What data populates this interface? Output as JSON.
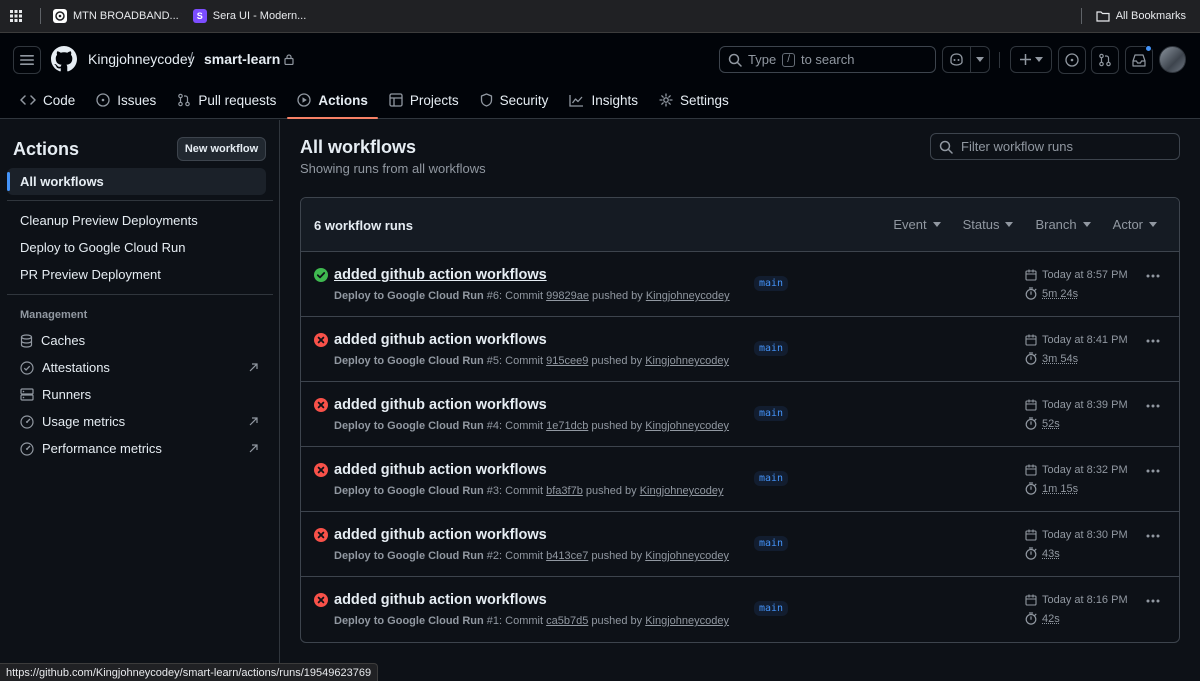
{
  "bookmarks": {
    "items": [
      {
        "label": "MTN BROADBAND...",
        "icon": "router-icon"
      },
      {
        "label": "Sera UI - Modern...",
        "icon": "sera-icon",
        "icon_letter": "S"
      }
    ],
    "all_bookmarks": "All Bookmarks"
  },
  "header": {
    "owner": "Kingjohneycodey",
    "separator": "/",
    "repo": "smart-learn",
    "search": {
      "prefix": "Type",
      "key": "/",
      "suffix": "to search"
    }
  },
  "tabs": [
    {
      "label": "Code",
      "icon": "code-icon"
    },
    {
      "label": "Issues",
      "icon": "issue-icon"
    },
    {
      "label": "Pull requests",
      "icon": "pull-request-icon"
    },
    {
      "label": "Actions",
      "icon": "play-icon",
      "active": true
    },
    {
      "label": "Projects",
      "icon": "table-icon"
    },
    {
      "label": "Security",
      "icon": "shield-icon"
    },
    {
      "label": "Insights",
      "icon": "graph-icon"
    },
    {
      "label": "Settings",
      "icon": "gear-icon"
    }
  ],
  "sidebar": {
    "title": "Actions",
    "new_workflow": "New workflow",
    "all_workflows": "All workflows",
    "workflows": [
      "Cleanup Preview Deployments",
      "Deploy to Google Cloud Run",
      "PR Preview Deployment"
    ],
    "management_heading": "Management",
    "management": [
      {
        "label": "Caches",
        "icon": "database-icon"
      },
      {
        "label": "Attestations",
        "icon": "verified-icon",
        "external": true
      },
      {
        "label": "Runners",
        "icon": "server-icon"
      },
      {
        "label": "Usage metrics",
        "icon": "meter-icon",
        "external": true
      },
      {
        "label": "Performance metrics",
        "icon": "meter-icon",
        "external": true
      }
    ]
  },
  "main": {
    "title": "All workflows",
    "subtitle": "Showing runs from all workflows",
    "filter_placeholder": "Filter workflow runs",
    "runs_count": "6 workflow runs",
    "filters": [
      "Event",
      "Status",
      "Branch",
      "Actor"
    ],
    "runs": [
      {
        "status": "success",
        "title": "added github action workflows",
        "workflow": "Deploy to Google Cloud Run",
        "number": "#6",
        "commit_word": "Commit",
        "commit": "99829ae",
        "pushed_by": "pushed by",
        "actor": "Kingjohneycodey",
        "branch": "main",
        "date": "Today at 8:57 PM",
        "duration": "5m 24s"
      },
      {
        "status": "failure",
        "title": "added github action workflows",
        "workflow": "Deploy to Google Cloud Run",
        "number": "#5",
        "commit_word": "Commit",
        "commit": "915cee9",
        "pushed_by": "pushed by",
        "actor": "Kingjohneycodey",
        "branch": "main",
        "date": "Today at 8:41 PM",
        "duration": "3m 54s"
      },
      {
        "status": "failure",
        "title": "added github action workflows",
        "workflow": "Deploy to Google Cloud Run",
        "number": "#4",
        "commit_word": "Commit",
        "commit": "1e71dcb",
        "pushed_by": "pushed by",
        "actor": "Kingjohneycodey",
        "branch": "main",
        "date": "Today at 8:39 PM",
        "duration": "52s"
      },
      {
        "status": "failure",
        "title": "added github action workflows",
        "workflow": "Deploy to Google Cloud Run",
        "number": "#3",
        "commit_word": "Commit",
        "commit": "bfa3f7b",
        "pushed_by": "pushed by",
        "actor": "Kingjohneycodey",
        "branch": "main",
        "date": "Today at 8:32 PM",
        "duration": "1m 15s"
      },
      {
        "status": "failure",
        "title": "added github action workflows",
        "workflow": "Deploy to Google Cloud Run",
        "number": "#2",
        "commit_word": "Commit",
        "commit": "b413ce7",
        "pushed_by": "pushed by",
        "actor": "Kingjohneycodey",
        "branch": "main",
        "date": "Today at 8:30 PM",
        "duration": "43s"
      },
      {
        "status": "failure",
        "title": "added github action workflows",
        "workflow": "Deploy to Google Cloud Run",
        "number": "#1",
        "commit_word": "Commit",
        "commit": "ca5b7d5",
        "pushed_by": "pushed by",
        "actor": "Kingjohneycodey",
        "branch": "main",
        "date": "Today at 8:16 PM",
        "duration": "42s"
      }
    ]
  },
  "status_bar": "https://github.com/Kingjohneycodey/smart-learn/actions/runs/19549623769",
  "colors": {
    "success": "#3fb950",
    "failure": "#f85149",
    "accent": "#4493f8",
    "tab_underline": "#f78166"
  }
}
